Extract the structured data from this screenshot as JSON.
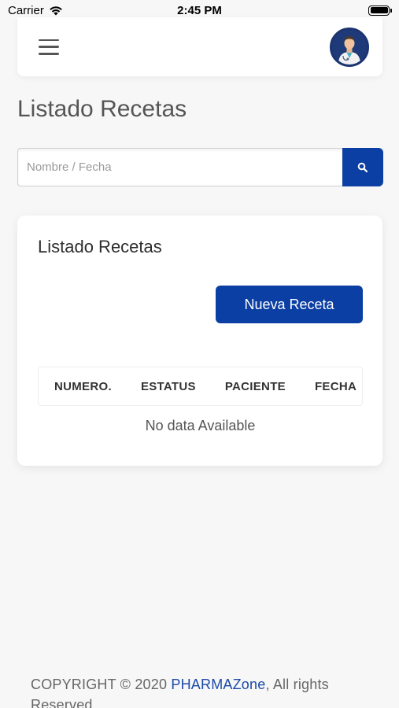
{
  "status_bar": {
    "carrier": "Carrier",
    "time": "2:45 PM"
  },
  "header": {
    "menu_icon": "hamburger-menu-icon",
    "avatar_icon": "doctor-avatar"
  },
  "page": {
    "title": "Listado Recetas"
  },
  "search": {
    "placeholder": "Nombre / Fecha",
    "value": "",
    "button_icon": "search-icon"
  },
  "card": {
    "title": "Listado Recetas",
    "new_button_label": "Nueva Receta",
    "table": {
      "columns": [
        "NUMERO.",
        "ESTATUS",
        "PACIENTE",
        "FECHA"
      ],
      "rows": [],
      "empty_message": "No data Available"
    }
  },
  "footer": {
    "prefix": "COPYRIGHT © 2020 ",
    "brand": "PHARMAZone",
    "suffix": ", All rights Reserved"
  },
  "colors": {
    "primary": "#0b3fa3",
    "background": "#f7f7f7",
    "link": "#1b4aa8"
  }
}
